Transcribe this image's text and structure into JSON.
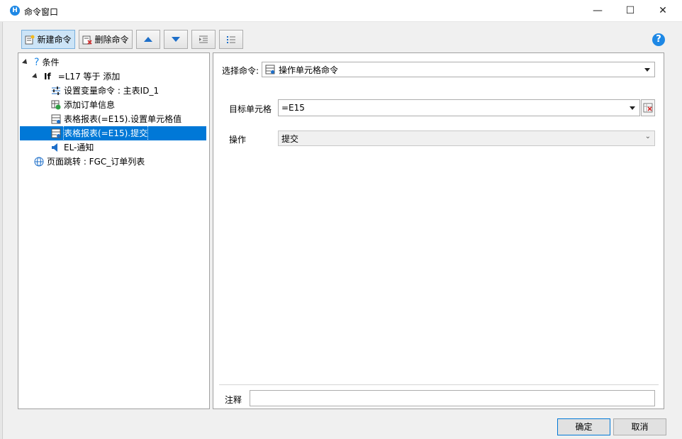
{
  "window": {
    "title": "命令窗口",
    "app_icon_letter": "H",
    "minimize": "—",
    "maximize": "☐",
    "close": "✕"
  },
  "toolbar": {
    "new_command": "新建命令",
    "delete_command": "删除命令",
    "help": "?"
  },
  "tree": {
    "condition_label": "条件",
    "if_keyword": "If",
    "if_expression": "=L17 等于 添加",
    "items": [
      "设置变量命令 : 主表ID_1",
      "添加订单信息",
      "表格报表(=E15).设置单元格值",
      "表格报表(=E15).提交",
      "EL-通知"
    ],
    "page_jump": "页面跳转 : FGC_订单列表"
  },
  "editor": {
    "select_command_label": "选择命令:",
    "select_command_value": "操作单元格命令",
    "target_cell_label": "目标单元格",
    "target_cell_value": "=E15",
    "operation_label": "操作",
    "operation_value": "提交",
    "comment_label": "注释",
    "comment_value": ""
  },
  "footer": {
    "ok": "确定",
    "cancel": "取消"
  },
  "colors": {
    "selection": "#0078d7",
    "accent": "#1e88e5"
  }
}
